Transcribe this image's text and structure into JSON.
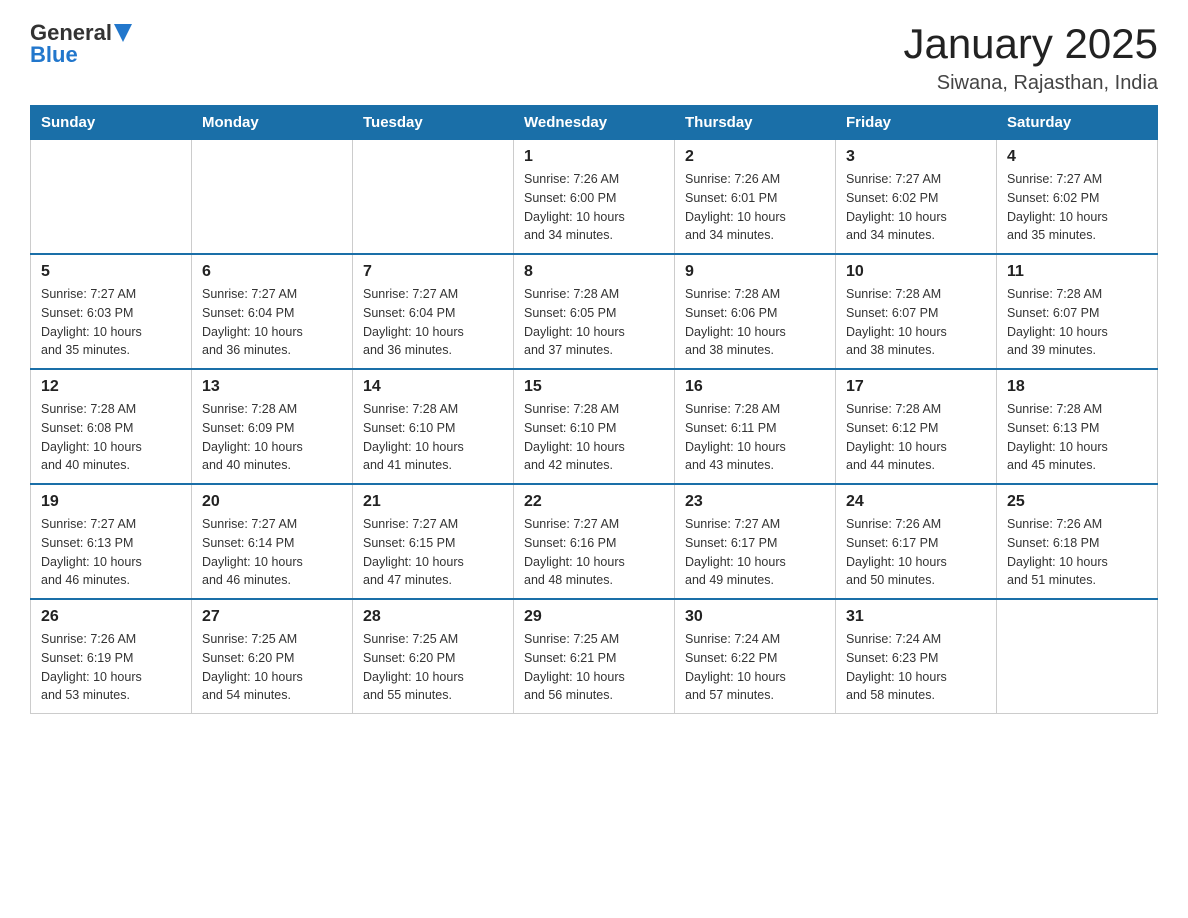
{
  "header": {
    "logo_general": "General",
    "logo_blue": "Blue",
    "month_title": "January 2025",
    "location": "Siwana, Rajasthan, India"
  },
  "days_of_week": [
    "Sunday",
    "Monday",
    "Tuesday",
    "Wednesday",
    "Thursday",
    "Friday",
    "Saturday"
  ],
  "weeks": [
    [
      {
        "day": "",
        "info": ""
      },
      {
        "day": "",
        "info": ""
      },
      {
        "day": "",
        "info": ""
      },
      {
        "day": "1",
        "info": "Sunrise: 7:26 AM\nSunset: 6:00 PM\nDaylight: 10 hours\nand 34 minutes."
      },
      {
        "day": "2",
        "info": "Sunrise: 7:26 AM\nSunset: 6:01 PM\nDaylight: 10 hours\nand 34 minutes."
      },
      {
        "day": "3",
        "info": "Sunrise: 7:27 AM\nSunset: 6:02 PM\nDaylight: 10 hours\nand 34 minutes."
      },
      {
        "day": "4",
        "info": "Sunrise: 7:27 AM\nSunset: 6:02 PM\nDaylight: 10 hours\nand 35 minutes."
      }
    ],
    [
      {
        "day": "5",
        "info": "Sunrise: 7:27 AM\nSunset: 6:03 PM\nDaylight: 10 hours\nand 35 minutes."
      },
      {
        "day": "6",
        "info": "Sunrise: 7:27 AM\nSunset: 6:04 PM\nDaylight: 10 hours\nand 36 minutes."
      },
      {
        "day": "7",
        "info": "Sunrise: 7:27 AM\nSunset: 6:04 PM\nDaylight: 10 hours\nand 36 minutes."
      },
      {
        "day": "8",
        "info": "Sunrise: 7:28 AM\nSunset: 6:05 PM\nDaylight: 10 hours\nand 37 minutes."
      },
      {
        "day": "9",
        "info": "Sunrise: 7:28 AM\nSunset: 6:06 PM\nDaylight: 10 hours\nand 38 minutes."
      },
      {
        "day": "10",
        "info": "Sunrise: 7:28 AM\nSunset: 6:07 PM\nDaylight: 10 hours\nand 38 minutes."
      },
      {
        "day": "11",
        "info": "Sunrise: 7:28 AM\nSunset: 6:07 PM\nDaylight: 10 hours\nand 39 minutes."
      }
    ],
    [
      {
        "day": "12",
        "info": "Sunrise: 7:28 AM\nSunset: 6:08 PM\nDaylight: 10 hours\nand 40 minutes."
      },
      {
        "day": "13",
        "info": "Sunrise: 7:28 AM\nSunset: 6:09 PM\nDaylight: 10 hours\nand 40 minutes."
      },
      {
        "day": "14",
        "info": "Sunrise: 7:28 AM\nSunset: 6:10 PM\nDaylight: 10 hours\nand 41 minutes."
      },
      {
        "day": "15",
        "info": "Sunrise: 7:28 AM\nSunset: 6:10 PM\nDaylight: 10 hours\nand 42 minutes."
      },
      {
        "day": "16",
        "info": "Sunrise: 7:28 AM\nSunset: 6:11 PM\nDaylight: 10 hours\nand 43 minutes."
      },
      {
        "day": "17",
        "info": "Sunrise: 7:28 AM\nSunset: 6:12 PM\nDaylight: 10 hours\nand 44 minutes."
      },
      {
        "day": "18",
        "info": "Sunrise: 7:28 AM\nSunset: 6:13 PM\nDaylight: 10 hours\nand 45 minutes."
      }
    ],
    [
      {
        "day": "19",
        "info": "Sunrise: 7:27 AM\nSunset: 6:13 PM\nDaylight: 10 hours\nand 46 minutes."
      },
      {
        "day": "20",
        "info": "Sunrise: 7:27 AM\nSunset: 6:14 PM\nDaylight: 10 hours\nand 46 minutes."
      },
      {
        "day": "21",
        "info": "Sunrise: 7:27 AM\nSunset: 6:15 PM\nDaylight: 10 hours\nand 47 minutes."
      },
      {
        "day": "22",
        "info": "Sunrise: 7:27 AM\nSunset: 6:16 PM\nDaylight: 10 hours\nand 48 minutes."
      },
      {
        "day": "23",
        "info": "Sunrise: 7:27 AM\nSunset: 6:17 PM\nDaylight: 10 hours\nand 49 minutes."
      },
      {
        "day": "24",
        "info": "Sunrise: 7:26 AM\nSunset: 6:17 PM\nDaylight: 10 hours\nand 50 minutes."
      },
      {
        "day": "25",
        "info": "Sunrise: 7:26 AM\nSunset: 6:18 PM\nDaylight: 10 hours\nand 51 minutes."
      }
    ],
    [
      {
        "day": "26",
        "info": "Sunrise: 7:26 AM\nSunset: 6:19 PM\nDaylight: 10 hours\nand 53 minutes."
      },
      {
        "day": "27",
        "info": "Sunrise: 7:25 AM\nSunset: 6:20 PM\nDaylight: 10 hours\nand 54 minutes."
      },
      {
        "day": "28",
        "info": "Sunrise: 7:25 AM\nSunset: 6:20 PM\nDaylight: 10 hours\nand 55 minutes."
      },
      {
        "day": "29",
        "info": "Sunrise: 7:25 AM\nSunset: 6:21 PM\nDaylight: 10 hours\nand 56 minutes."
      },
      {
        "day": "30",
        "info": "Sunrise: 7:24 AM\nSunset: 6:22 PM\nDaylight: 10 hours\nand 57 minutes."
      },
      {
        "day": "31",
        "info": "Sunrise: 7:24 AM\nSunset: 6:23 PM\nDaylight: 10 hours\nand 58 minutes."
      },
      {
        "day": "",
        "info": ""
      }
    ]
  ]
}
